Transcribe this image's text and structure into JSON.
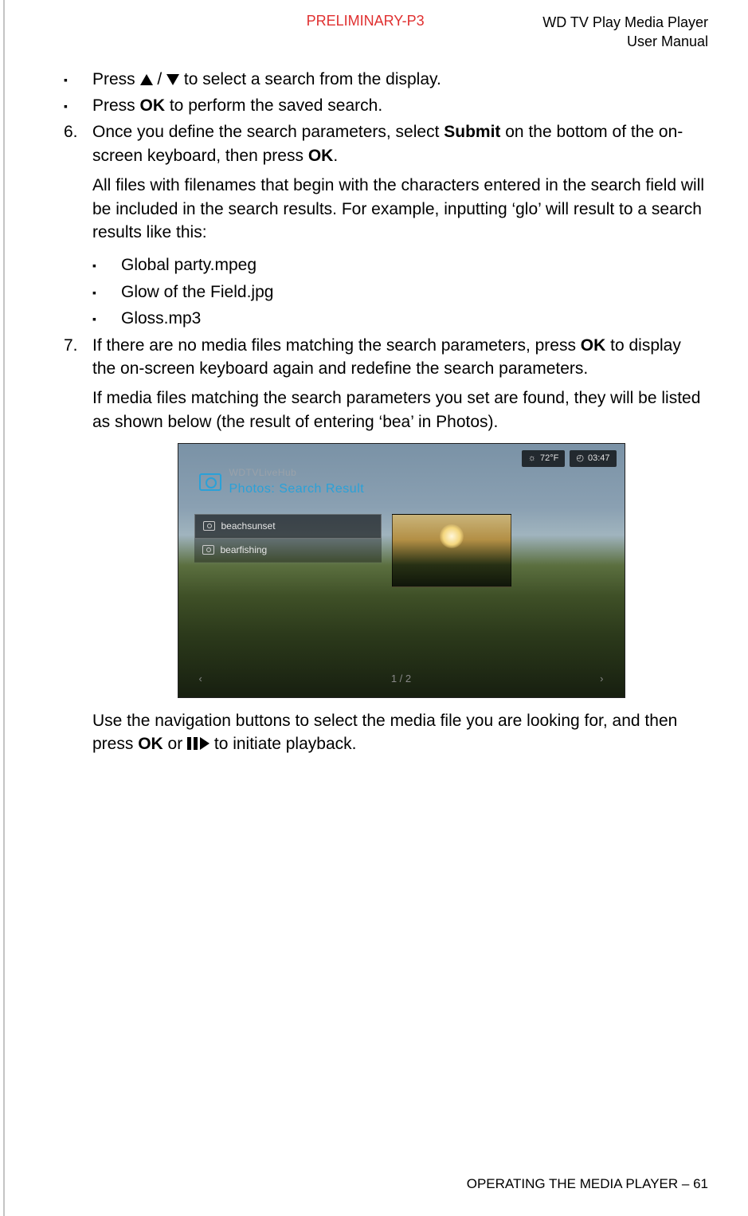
{
  "header": {
    "watermark": "PRELIMINARY-P3",
    "product": "WD TV Play Media Player",
    "doc_type": "User Manual"
  },
  "body": {
    "b1_pre": "Press ",
    "b1_mid": " / ",
    "b1_post": " to select a search from the display.",
    "b2_pre": "Press ",
    "b2_bold": "OK",
    "b2_post": " to perform the saved search.",
    "n6_num": "6.",
    "n6_p1a": "Once you define the search parameters, select ",
    "n6_p1b": "Submit",
    "n6_p1c": " on the bottom of the on-screen keyboard, then press ",
    "n6_p1d": "OK",
    "n6_p1e": ".",
    "n6_p2": "All files with filenames that begin with the characters entered in the search field will be included in the search results. For example, inputting ‘glo’ will result to a search results like this:",
    "ex1": "Global party.mpeg",
    "ex2": "Glow of the Field.jpg",
    "ex3": "Gloss.mp3",
    "n7_num": "7.",
    "n7_p1a": "If there are no media files matching the search parameters, press ",
    "n7_p1b": "OK",
    "n7_p1c": " to display the on-screen keyboard again and redefine the search parameters.",
    "n7_p2": "If media files matching the search parameters you set are found, they will be listed as shown below (the result of entering ‘bea’ in Photos).",
    "n7_p3a": "Use the navigation buttons to select the media file you are looking for, and then press ",
    "n7_p3b": "OK",
    "n7_p3c": " or ",
    "n7_p3d": " to initiate playback."
  },
  "figure": {
    "temp": "72°F",
    "time": "03:47",
    "source": "WDTVLiveHub",
    "title": "Photos: Search Result",
    "items": [
      "beachsunset",
      "bearfishing"
    ],
    "pager": "1 / 2",
    "prev": "‹",
    "next": "›"
  },
  "footer": {
    "section": "OPERATING THE MEDIA PLAYER",
    "sep": " – ",
    "page": "61"
  }
}
